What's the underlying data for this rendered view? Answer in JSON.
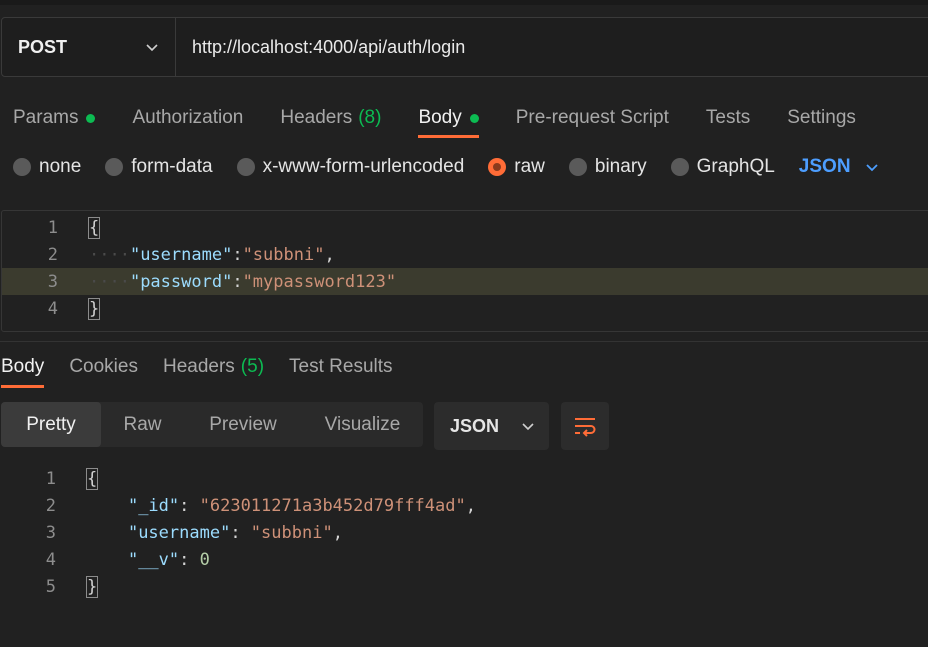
{
  "request": {
    "method": "POST",
    "url": "http://localhost:4000/api/auth/login"
  },
  "req_tabs": {
    "params": "Params",
    "authorization": "Authorization",
    "headers": "Headers",
    "headers_count": "(8)",
    "body": "Body",
    "pre_request": "Pre-request Script",
    "tests": "Tests",
    "settings": "Settings"
  },
  "body_types": {
    "none": "none",
    "form_data": "form-data",
    "urlencoded": "x-www-form-urlencoded",
    "raw": "raw",
    "binary": "binary",
    "graphql": "GraphQL",
    "selected_lang": "JSON"
  },
  "request_body": {
    "line_numbers": [
      "1",
      "2",
      "3",
      "4"
    ],
    "open": "{",
    "indent": "····",
    "k1": "\"username\"",
    "v1": "\"subbni\"",
    "k2": "\"password\"",
    "v2": "\"mypassword123\"",
    "close": "}"
  },
  "res_tabs": {
    "body": "Body",
    "cookies": "Cookies",
    "headers": "Headers",
    "headers_count": "(5)",
    "test_results": "Test Results"
  },
  "views": {
    "pretty": "Pretty",
    "raw": "Raw",
    "preview": "Preview",
    "visualize": "Visualize",
    "lang": "JSON"
  },
  "response_body": {
    "line_numbers": [
      "1",
      "2",
      "3",
      "4",
      "5"
    ],
    "open": "{",
    "k1": "\"_id\"",
    "v1": "\"623011271a3b452d79fff4ad\"",
    "k2": "\"username\"",
    "v2": "\"subbni\"",
    "k3": "\"__v\"",
    "v3": "0",
    "close": "}"
  },
  "colors": {
    "accent": "#ff6c37",
    "green": "#0cbb52",
    "blue": "#4d9eff"
  }
}
